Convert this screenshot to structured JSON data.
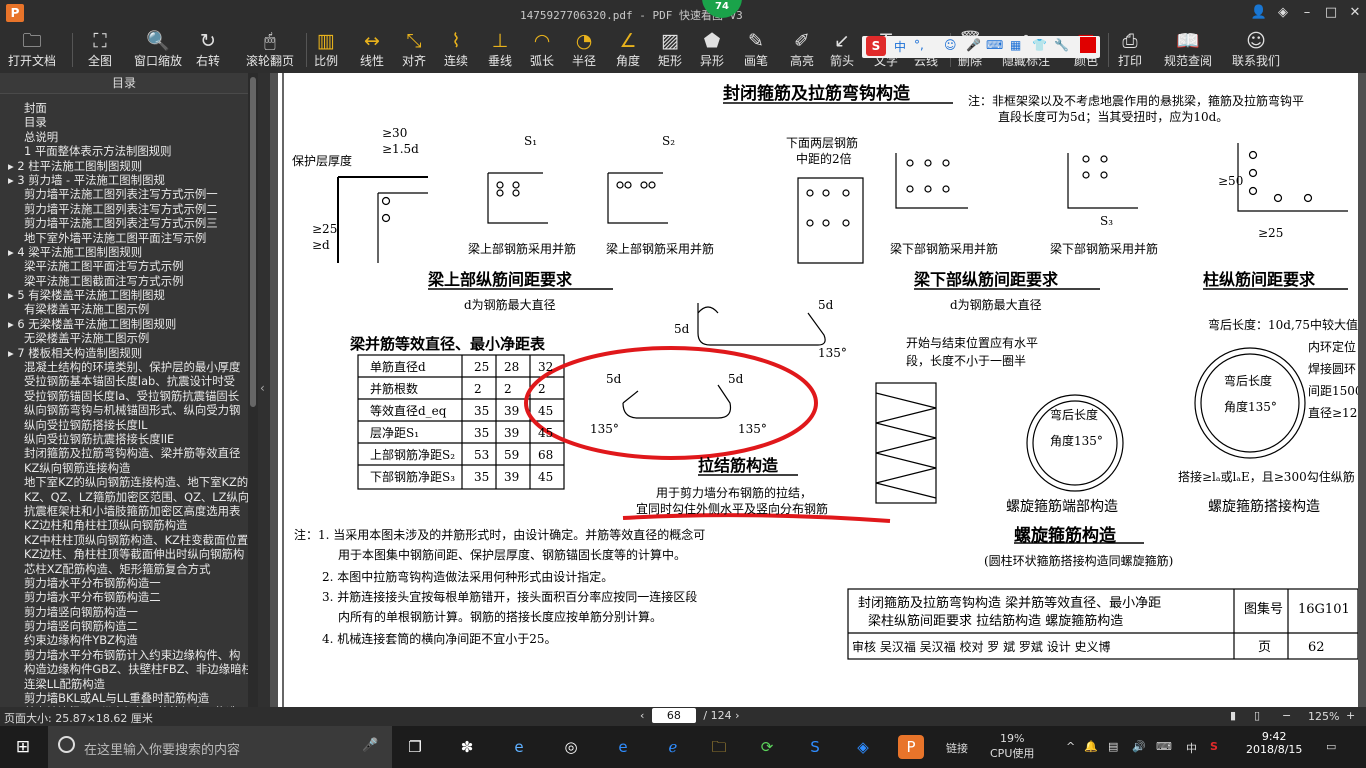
{
  "window": {
    "title": "1475927706320.pdf - PDF 快速看图 V3",
    "app_icon": "P",
    "badge": "74",
    "buttons": [
      "user-icon",
      "skin-icon",
      "minimize-icon",
      "maximize-icon",
      "close-icon"
    ]
  },
  "toolbar": [
    {
      "label": "打开文档",
      "icon": "folder-icon",
      "glyph": "🗀"
    },
    {
      "label": "全图",
      "icon": "fullscreen-icon",
      "glyph": "⛶"
    },
    {
      "label": "窗口缩放",
      "icon": "zoom-window-icon",
      "glyph": "🔍"
    },
    {
      "label": "右转",
      "icon": "rotate-right-icon",
      "glyph": "↻"
    },
    {
      "label": "滚轮翻页",
      "icon": "mouse-wheel-icon",
      "glyph": "🖱"
    },
    {
      "label": "比例",
      "icon": "scale-icon",
      "glyph": "▥"
    },
    {
      "label": "线性",
      "icon": "linear-measure-icon",
      "glyph": "↔"
    },
    {
      "label": "对齐",
      "icon": "aligned-measure-icon",
      "glyph": "⤡"
    },
    {
      "label": "连续",
      "icon": "continuous-measure-icon",
      "glyph": "⌇"
    },
    {
      "label": "垂线",
      "icon": "perpendicular-icon",
      "glyph": "⊥"
    },
    {
      "label": "弧长",
      "icon": "arc-length-icon",
      "glyph": "◠"
    },
    {
      "label": "半径",
      "icon": "radius-icon",
      "glyph": "◔"
    },
    {
      "label": "角度",
      "icon": "angle-icon",
      "glyph": "∠"
    },
    {
      "label": "矩形",
      "icon": "rectangle-area-icon",
      "glyph": "▨"
    },
    {
      "label": "异形",
      "icon": "polygon-area-icon",
      "glyph": "⬟"
    },
    {
      "label": "画笔",
      "icon": "pen-icon",
      "glyph": "✎"
    },
    {
      "label": "高亮",
      "icon": "highlighter-icon",
      "glyph": "✐"
    },
    {
      "label": "箭头",
      "icon": "arrow-icon",
      "glyph": "↙"
    },
    {
      "label": "文字",
      "icon": "text-icon",
      "glyph": "T"
    },
    {
      "label": "云线",
      "icon": "cloud-line-icon",
      "glyph": "☁"
    },
    {
      "label": "删除",
      "icon": "delete-icon",
      "glyph": "🗑"
    },
    {
      "label": "隐藏标注",
      "icon": "hide-markup-icon",
      "glyph": "◌"
    },
    {
      "label": "颜色",
      "icon": "color-icon",
      "glyph": "■"
    },
    {
      "label": "打印",
      "icon": "print-icon",
      "glyph": "⎙"
    },
    {
      "label": "规范查阅",
      "icon": "standards-book-icon",
      "glyph": "📖"
    },
    {
      "label": "联系我们",
      "icon": "contact-icon",
      "glyph": "☺"
    }
  ],
  "ime": {
    "logo": "S",
    "mode": "中"
  },
  "sidebar": {
    "header": "目录",
    "items": [
      "封面",
      "目录",
      "总说明",
      "1 平面整体表示方法制图规则",
      "▸ 2 柱平法施工图制图规则",
      "▸ 3 剪力墙 - 平法施工图制图规",
      "剪力墙平法施工图列表注写方式示例一",
      "剪力墙平法施工图列表注写方式示例二",
      "剪力墙平法施工图列表注写方式示例三",
      "地下室外墙平法施工图平面注写示例",
      "▸ 4 梁平法施工图制图规则",
      "梁平法施工图平面注写方式示例",
      "梁平法施工图截面注写方式示例",
      "▸ 5 有梁楼盖平法施工图制图规",
      "有梁楼盖平法施工图示例",
      "▸ 6 无梁楼盖平法施工图制图规则",
      "无梁楼盖平法施工图示例",
      "▸ 7 楼板相关构造制图规则",
      "混凝土结构的环境类别、保护层的最小厚度",
      "受拉钢筋基本锚固长度lab、抗震设计时受",
      "受拉钢筋锚固长度la、受拉钢筋抗震锚固长",
      "纵向钢筋弯钩与机械锚固形式、纵向受力钢",
      "纵向受拉钢筋搭接长度lL",
      "纵向受拉钢筋抗震搭接长度llE",
      "封闭箍筋及拉筋弯钩构造、梁并筋等效直径",
      "KZ纵向钢筋连接构造",
      "地下室KZ的纵向钢筋连接构造、地下室KZ的",
      "KZ、QZ、LZ箍筋加密区范围、QZ、LZ纵向钢",
      "抗震框架柱和小墙肢箍筋加密区高度选用表",
      "KZ边柱和角柱柱顶纵向钢筋构造",
      "KZ中柱柱顶纵向钢筋构造、KZ柱变截面位置",
      "KZ边柱、角柱柱顶等截面伸出时纵向钢筋构",
      "芯柱XZ配筋构造、矩形箍筋复合方式",
      "剪力墙水平分布钢筋构造一",
      "剪力墙水平分布钢筋构造二",
      "剪力墙竖向钢筋构造一",
      "剪力墙竖向钢筋构造二",
      "约束边缘构件YBZ构造",
      "剪力墙水平分布钢筋计入约束边缘构件、构",
      "构造边缘构件GBZ、扶壁柱FBZ、非边缘暗柱",
      "连梁LL配筋构造",
      "剪力墙BKL或AL与LL重叠时配筋构造",
      "剪力墙连梁LLK纵向钢筋、箍筋加密区构造"
    ]
  },
  "drawing": {
    "title_main": "封闭箍筋及拉筋弯钩构造",
    "note_top": "注：非框架梁以及不考虑地震作用的悬挑梁，箍筋及拉筋弯钩平",
    "note_top2": "直段长度可为5d；当其受扭时，应为10d。",
    "cover_label": "保护层厚度",
    "gt30": "≥30",
    "gt15d": "≥1.5d",
    "gt25": "≥25",
    "gtd": "≥d",
    "s1": "S₁",
    "s2": "S₂",
    "s3": "S₃",
    "bottom_two_layers": "下面两层钢筋",
    "bottom_two_layers2": "中距的2倍",
    "upper_bundled_1": "梁上部钢筋采用并筋",
    "upper_bundled_2": "梁上部钢筋采用并筋",
    "lower_bundled_1": "梁下部钢筋采用并筋",
    "lower_bundled_2": "梁下部钢筋采用并筋",
    "upper_heading": "梁上部纵筋间距要求",
    "upper_sub": "d为钢筋最大直径",
    "lower_heading": "梁下部纵筋间距要求",
    "lower_sub": "d为钢筋最大直径",
    "col_heading": "柱纵筋间距要求",
    "gt50": "≥50",
    "gt25b": "≥25",
    "five_d": "5d",
    "deg135": "135°",
    "tie_heading": "拉结筋构造",
    "tie_sub1": "用于剪力墙分布钢筋的拉结，",
    "tie_sub2": "宜同时勾住外侧水平及竖向分布钢筋",
    "spiral_text1": "开始与结束位置应有水平",
    "spiral_text2": "段，长度不小于一圈半",
    "bend_len": "弯后长度",
    "bend_angle": "角度135°",
    "bend_note": "弯后长度：10d,75中较大值",
    "inner_ring1": "内环定位",
    "inner_ring2": "焊接圆环",
    "inner_ring3": "间距1500",
    "inner_ring4": "直径≥12",
    "lap_note": "搭接≥lₐ或lₐE，且≥300勾住纵筋",
    "spiral_end": "螺旋箍筋端部构造",
    "spiral_lap": "螺旋箍筋搭接构造",
    "spiral_heading": "螺旋箍筋构造",
    "spiral_sub": "(圆柱环状箍筋搭接构造同螺旋箍筋)",
    "notes": [
      "注：1. 当采用本图未涉及的并筋形式时，由设计确定。并筋等效直径的概念可",
      "用于本图集中钢筋间距、保护层厚度、钢筋锚固长度等的计算中。",
      "2. 本图中拉筋弯钩构造做法采用何种形式由设计指定。",
      "3. 并筋连接接头宜按每根单筋错开，接头面积百分率应按同一连接区段",
      "内所有的单根钢筋计算。钢筋的搭接长度应按单筋分别计算。",
      "4. 机械连接套筒的横向净间距不宜小于25。"
    ],
    "table": {
      "title": "梁并筋等效直径、最小净距表",
      "rows": [
        {
          "label": "单筋直径d",
          "v": [
            "25",
            "28",
            "32"
          ]
        },
        {
          "label": "并筋根数",
          "v": [
            "2",
            "2",
            "2"
          ]
        },
        {
          "label": "等效直径d_eq",
          "v": [
            "35",
            "39",
            "45"
          ]
        },
        {
          "label": "层净距S₁",
          "v": [
            "35",
            "39",
            "45"
          ]
        },
        {
          "label": "上部钢筋净距S₂",
          "v": [
            "53",
            "59",
            "68"
          ]
        },
        {
          "label": "下部钢筋净距S₃",
          "v": [
            "35",
            "39",
            "45"
          ]
        }
      ]
    },
    "titleblock": {
      "line1": "封闭箍筋及拉筋弯钩构造  梁并筋等效直径、最小净距",
      "line2": "梁柱纵筋间距要求   拉结筋构造   螺旋箍筋构造",
      "atlas_label": "图集号",
      "atlas_no": "16G101",
      "page_label": "页",
      "page_no": "62",
      "sign": "审核 吴汉福  吴汉福  校对 罗  斌  罗斌  设计 史义博"
    }
  },
  "status": {
    "page_size": "页面大小: 25.87×18.62 厘米",
    "current_page": "68",
    "total_pages": "/ 124",
    "zoom": "125%"
  },
  "taskbar": {
    "search_placeholder": "在这里输入你要搜索的内容",
    "cpu_percent": "19%",
    "cpu_label": "CPU使用",
    "link_label": "链接",
    "time": "9:42",
    "date": "2018/8/15",
    "lang": "中"
  },
  "colors": {
    "annotation_red": "#e0181b",
    "ime_blue": "#1a6fd6",
    "badge_green": "#1aa34a"
  }
}
